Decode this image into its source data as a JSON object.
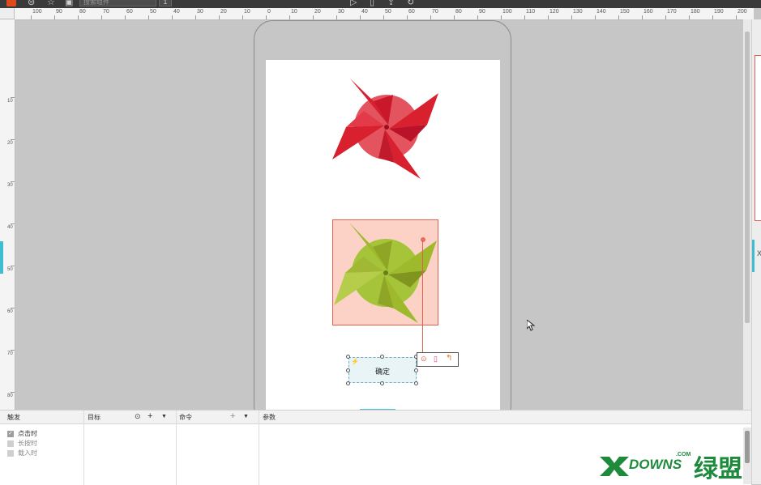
{
  "toolbar": {
    "search_placeholder": "搜索组件",
    "page_number": "1"
  },
  "ruler": {
    "h_labels": [
      "100",
      "90",
      "80",
      "70",
      "60",
      "50",
      "40",
      "30",
      "20",
      "10",
      "0",
      "10",
      "20",
      "30",
      "40",
      "50",
      "60",
      "70",
      "80",
      "90",
      "100",
      "110",
      "120",
      "130",
      "140",
      "150",
      "160",
      "170",
      "180",
      "190",
      "200"
    ],
    "v_labels": [
      "10",
      "20",
      "30",
      "40",
      "50",
      "60",
      "70",
      "80"
    ]
  },
  "canvas": {
    "button_label": "确定"
  },
  "interaction_panel": {
    "headers": {
      "trigger": "触发",
      "target": "目标",
      "command": "命令",
      "params": "参数"
    },
    "triggers": [
      {
        "label": "点击时",
        "checked": true
      },
      {
        "label": "长按时",
        "checked": false
      },
      {
        "label": "载入时",
        "checked": false
      }
    ]
  },
  "right_panel": {
    "letter": "X"
  },
  "watermark": {
    "text": "DOWNS",
    "suffix": ".COM",
    "cn": "绿盟",
    "mark": "X"
  },
  "colors": {
    "accent": "#e0491d",
    "selection": "#e06050",
    "selection_fill": "#fcd2c6",
    "brand_green": "#1e8a3c",
    "red_pinwheel": "#d8202f",
    "green_pinwheel": "#a5c43a"
  }
}
